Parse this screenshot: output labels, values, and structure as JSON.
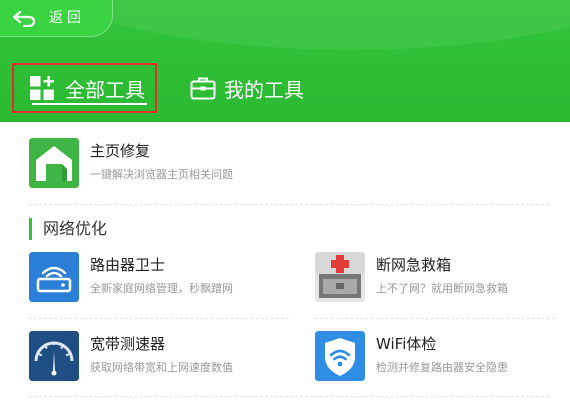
{
  "window": {
    "back_label": "返回"
  },
  "tabs": [
    {
      "label": "全部工具",
      "active": true
    },
    {
      "label": "我的工具",
      "active": false
    }
  ],
  "featured": {
    "title": "主页修复",
    "desc": "一键解决浏览器主页相关问题",
    "icon": "home-repair-icon"
  },
  "section": {
    "title": "网络优化"
  },
  "tools": [
    {
      "title": "路由器卫士",
      "desc": "全新家庭网络管理，秒飘蹭网",
      "icon": "router-icon"
    },
    {
      "title": "断网急救箱",
      "desc": "上不了网？就用断网急救箱",
      "icon": "first-aid-kit-icon"
    },
    {
      "title": "宽带测速器",
      "desc": "获取网络带宽和上网速度数值",
      "icon": "speedometer-icon"
    },
    {
      "title": "WiFi体检",
      "desc": "检测并修复路由器安全隐患",
      "icon": "wifi-check-icon"
    }
  ],
  "colors": {
    "header_green": "#31c53a",
    "tab_highlight_border": "#e12f2a",
    "section_accent": "#35c23a"
  }
}
